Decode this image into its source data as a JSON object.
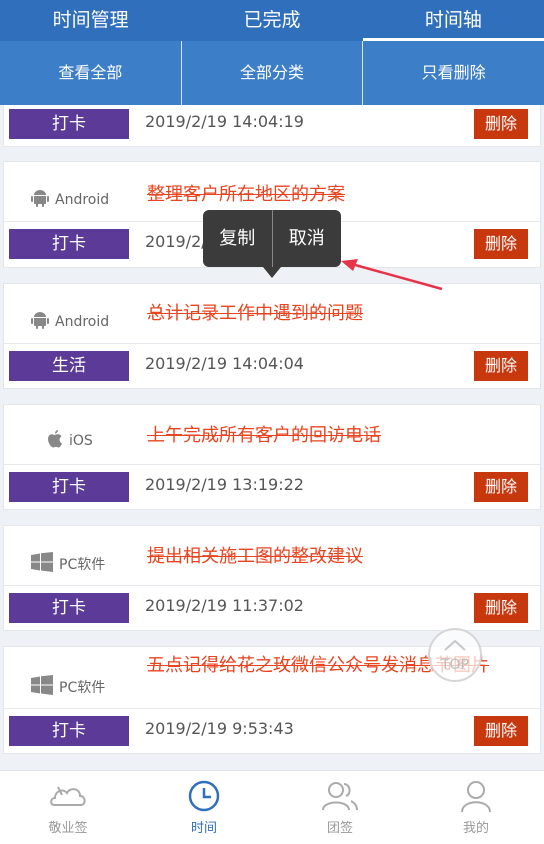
{
  "tabs": [
    {
      "label": "时间管理",
      "active": false
    },
    {
      "label": "已完成",
      "active": false
    },
    {
      "label": "时间轴",
      "active": true
    }
  ],
  "subbar": [
    "查看全部",
    "全部分类",
    "只看删除"
  ],
  "first_row": {
    "tag": "打卡",
    "time": "2019/2/19 14:04:19",
    "delete": "删除"
  },
  "cards": [
    {
      "platform": "Android",
      "platform_icon": "android-icon",
      "task": "整理客户所在地区的方案",
      "tag": "打卡",
      "time": "2019/2/19 14:04:2",
      "delete": "删除"
    },
    {
      "platform": "Android",
      "platform_icon": "android-icon",
      "task": "总计记录工作中遇到的问题",
      "tag": "生活",
      "time": "2019/2/19 14:04:04",
      "delete": "删除"
    },
    {
      "platform": "iOS",
      "platform_icon": "apple-icon",
      "task": "上午完成所有客户的回访电话",
      "tag": "打卡",
      "time": "2019/2/19 13:19:22",
      "delete": "删除"
    },
    {
      "platform": "PC软件",
      "platform_icon": "windows-icon",
      "task": "提出相关施工图的整改建议",
      "tag": "打卡",
      "time": "2019/2/19 11:37:02",
      "delete": "删除"
    },
    {
      "platform": "PC软件",
      "platform_icon": "windows-icon",
      "task": "五点记得给花之玫微信公众号发消息节图片",
      "tag": "打卡",
      "time": "2019/2/19 9:53:43",
      "delete": "删除"
    }
  ],
  "popup": {
    "copy": "复制",
    "cancel": "取消"
  },
  "top_button": "TOP",
  "bottom_nav": [
    {
      "label": "敬业签",
      "icon": "cloud-icon",
      "active": false
    },
    {
      "label": "时间",
      "icon": "clock-icon",
      "active": true
    },
    {
      "label": "团签",
      "icon": "group-icon",
      "active": false
    },
    {
      "label": "我的",
      "icon": "person-icon",
      "active": false
    }
  ],
  "colors": {
    "header": "#2f6fbb",
    "subbar": "#3d7ec9",
    "tag": "#5b3b97",
    "delete": "#c8380e",
    "task_text": "#e8441f",
    "arrow": "#e5344a"
  }
}
